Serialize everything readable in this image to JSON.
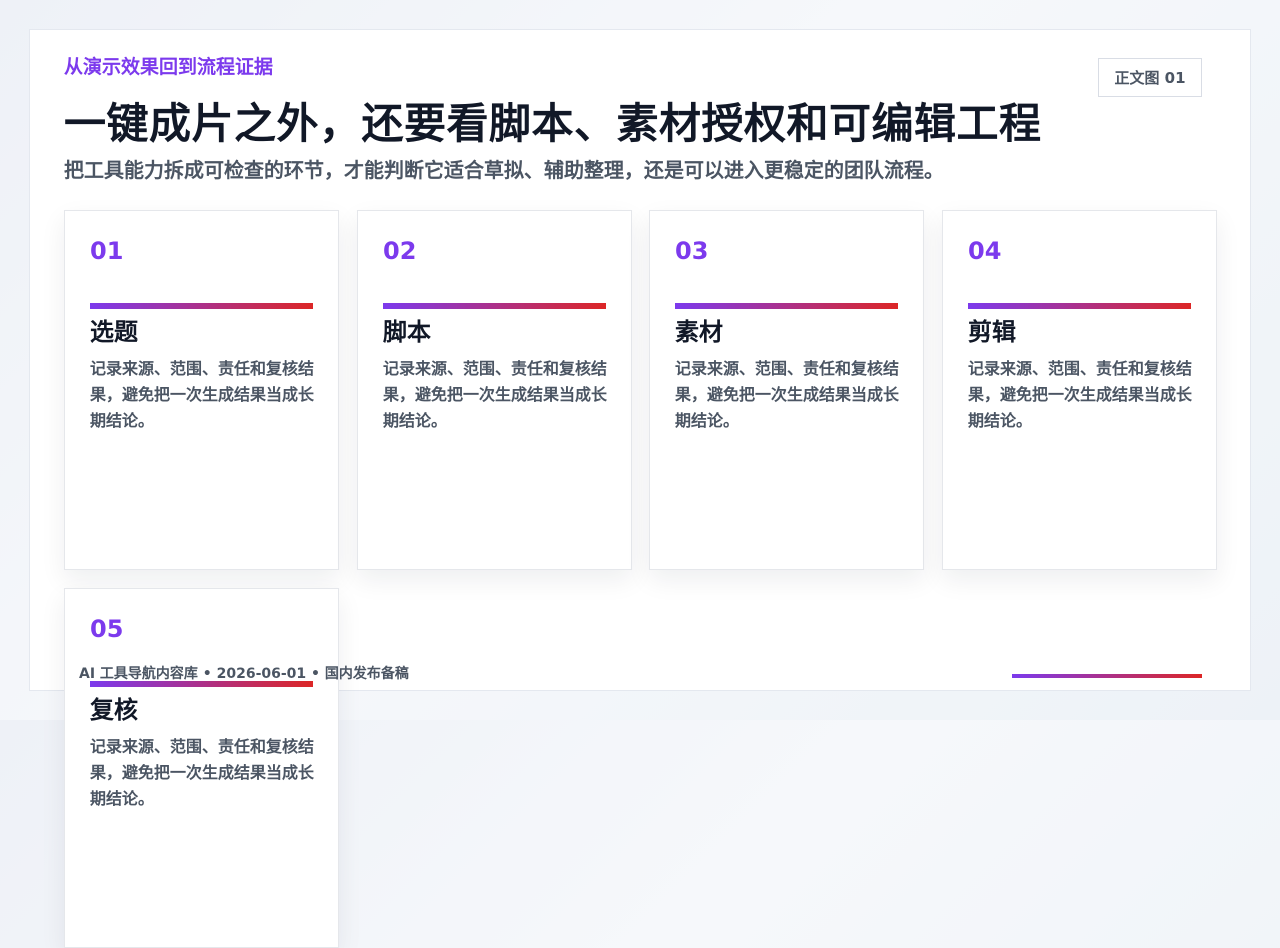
{
  "eyebrow": "从演示效果回到流程证据",
  "title": "一键成片之外，还要看脚本、素材授权和可编辑工程",
  "subtitle": "把工具能力拆成可检查的环节，才能判断它适合草拟、辅助整理，还是可以进入更稳定的团队流程。",
  "badge": "正文图 01",
  "cards": [
    {
      "num": "01",
      "title": "选题",
      "body": "记录来源、范围、责任和复核结果，避免把一次生成结果当成长期结论。"
    },
    {
      "num": "02",
      "title": "脚本",
      "body": "记录来源、范围、责任和复核结果，避免把一次生成结果当成长期结论。"
    },
    {
      "num": "03",
      "title": "素材",
      "body": "记录来源、范围、责任和复核结果，避免把一次生成结果当成长期结论。"
    },
    {
      "num": "04",
      "title": "剪辑",
      "body": "记录来源、范围、责任和复核结果，避免把一次生成结果当成长期结论。"
    },
    {
      "num": "05",
      "title": "复核",
      "body": "记录来源、范围、责任和复核结果，避免把一次生成结果当成长期结论。"
    }
  ],
  "footer": "AI 工具导航内容库 • 2026-06-01 • 国内发布备稿",
  "colors": {
    "accent": "#7c3aed",
    "accent_end": "#dc2626",
    "heading": "#111827",
    "muted": "#4b5563"
  }
}
